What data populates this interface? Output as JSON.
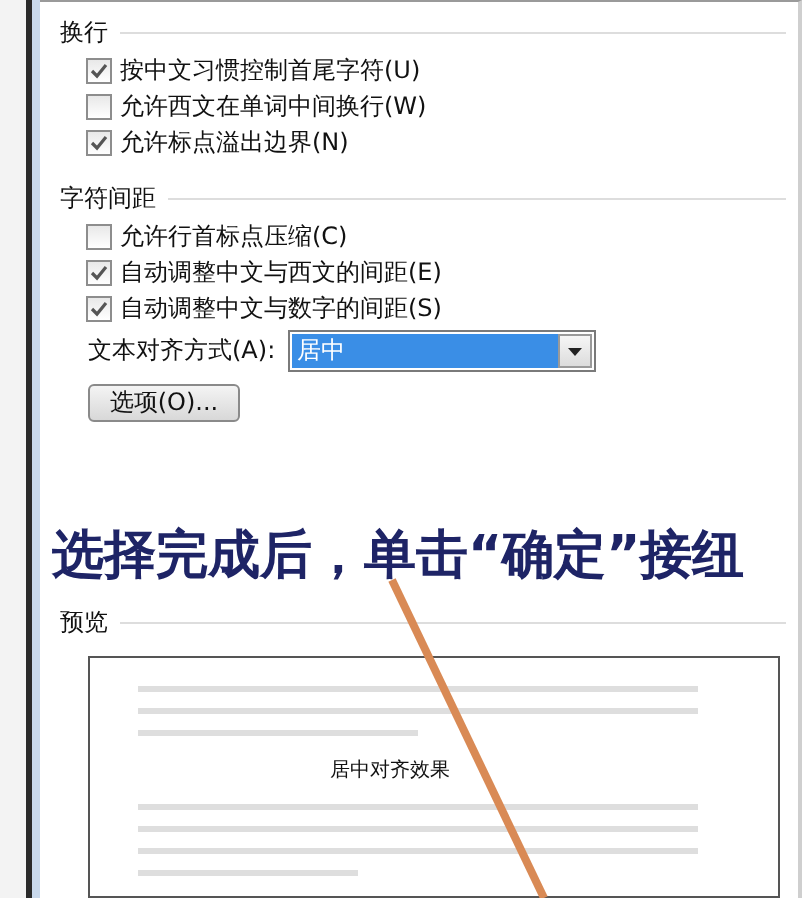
{
  "sections": [
    {
      "title": "换行",
      "options": [
        {
          "label": "按中文习惯控制首尾字符(U)",
          "checked": true
        },
        {
          "label": "允许西文在单词中间换行(W)",
          "checked": false
        },
        {
          "label": "允许标点溢出边界(N)",
          "checked": true
        }
      ]
    },
    {
      "title": "字符间距",
      "options": [
        {
          "label": "允许行首标点压缩(C)",
          "checked": false
        },
        {
          "label": "自动调整中文与西文的间距(E)",
          "checked": true
        },
        {
          "label": "自动调整中文与数字的间距(S)",
          "checked": true
        }
      ]
    }
  ],
  "alignment": {
    "label": "文本对齐方式(A):",
    "value": "居中"
  },
  "options_button": "选项(O)...",
  "annotation": "选择完成后，单击“确定”接纽",
  "preview": {
    "title": "预览",
    "sample": "居中对齐效果"
  }
}
